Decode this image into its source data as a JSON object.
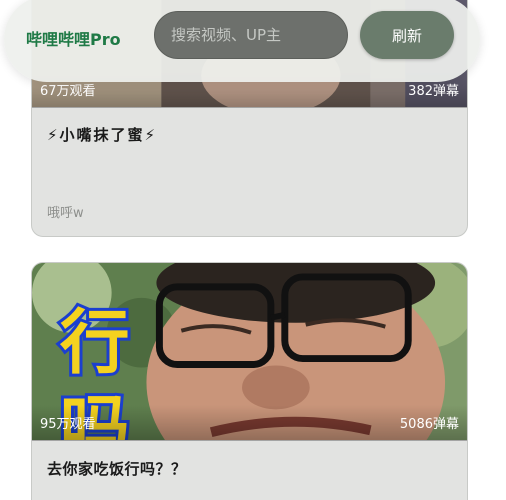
{
  "app": {
    "brand": "哔哩哔哩Pro",
    "brand_color": "#1f7a46"
  },
  "search": {
    "placeholder": "搜索视频、UP主",
    "value": ""
  },
  "actions": {
    "refresh_label": "刷新"
  },
  "videos": [
    {
      "views": "67万观看",
      "danmaku": "382弹幕",
      "title": "⚡小嘴抹了蜜⚡",
      "author": "哦呼w"
    },
    {
      "views": "95万观看",
      "danmaku": "5086弹幕",
      "title": "去你家吃饭行吗？？",
      "thumbnail_caption": "行吗"
    }
  ]
}
